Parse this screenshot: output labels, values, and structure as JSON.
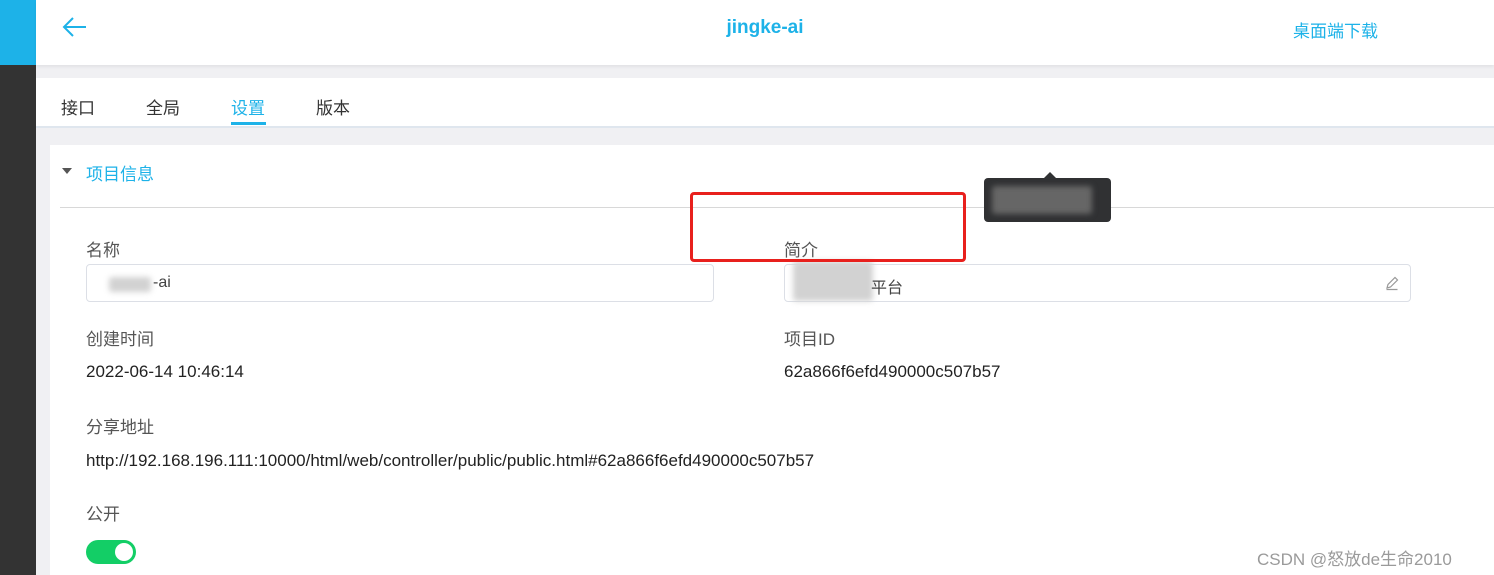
{
  "header": {
    "title": "jingke-ai",
    "download_label": "桌面端下载"
  },
  "tabs": [
    {
      "label": "接口"
    },
    {
      "label": "全局"
    },
    {
      "label": "设置",
      "active": true
    },
    {
      "label": "版本"
    }
  ],
  "section": {
    "title": "项目信息"
  },
  "fields": {
    "name_label": "名称",
    "name_value": "-ai",
    "intro_label": "简介",
    "intro_value": "平台",
    "created_label": "创建时间",
    "created_value": "2022-06-14 10:46:14",
    "project_id_label": "项目ID",
    "project_id_value": "62a866f6efd490000c507b57",
    "share_label": "分享地址",
    "share_value": "http://192.168.196.111:10000/html/web/controller/public/public.html#62a866f6efd490000c507b57",
    "public_label": "公开",
    "public_enabled": true
  },
  "colors": {
    "accent": "#1db2e8",
    "sidebar": "#333333",
    "toggle_on": "#13ce66",
    "highlight": "#e8201d"
  },
  "watermark": "CSDN @怒放de生命2010"
}
